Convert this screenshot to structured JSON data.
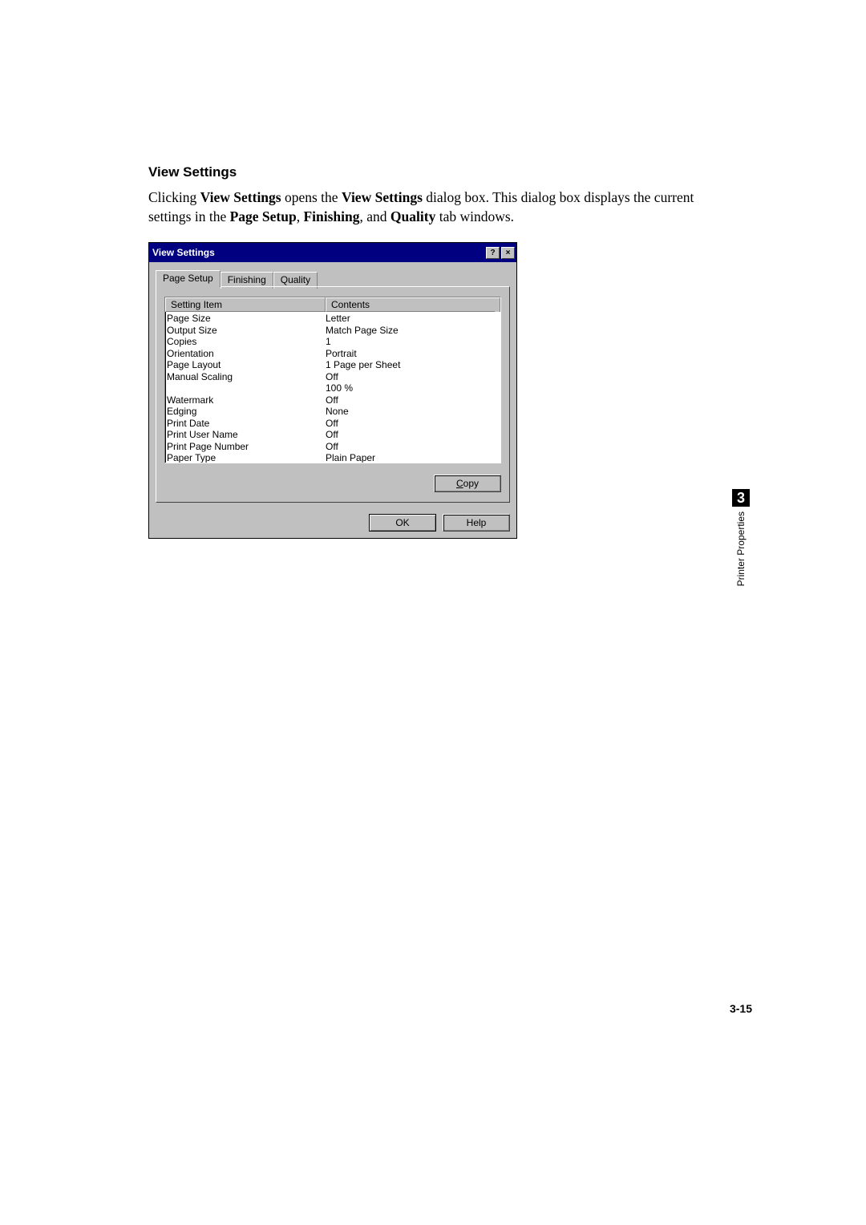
{
  "doc": {
    "section_heading": "View Settings",
    "para_pre": "Clicking ",
    "para_b1": "View Settings",
    "para_mid1": " opens the ",
    "para_b2": "View Settings",
    "para_mid2": " dialog box. This dialog box displays the current settings in the ",
    "para_b3": "Page Setup",
    "para_sep1": ", ",
    "para_b4": "Finishing",
    "para_sep2": ", and ",
    "para_b5": "Quality",
    "para_end": " tab windows."
  },
  "side_tab": {
    "number": "3",
    "label": "Printer Properties"
  },
  "page_number": "3-15",
  "dialog": {
    "title": "View Settings",
    "help_glyph": "?",
    "close_glyph": "×",
    "tabs": {
      "page_setup": "Page Setup",
      "finishing": "Finishing",
      "quality": "Quality"
    },
    "headers": {
      "item": "Setting Item",
      "contents": "Contents"
    },
    "rows_item": "Page Size\nOutput Size\nCopies\nOrientation\nPage Layout\nManual Scaling\n\nWatermark\nEdging\nPrint Date\nPrint User Name\nPrint Page Number\nPaper Type",
    "rows_contents": "Letter\nMatch Page Size\n1\nPortrait\n1 Page per Sheet\nOff\n100 %\nOff\nNone\nOff\nOff\nOff\nPlain Paper",
    "buttons": {
      "copy_u": "C",
      "copy_rest": "opy",
      "ok": "OK",
      "help": "Help"
    }
  }
}
